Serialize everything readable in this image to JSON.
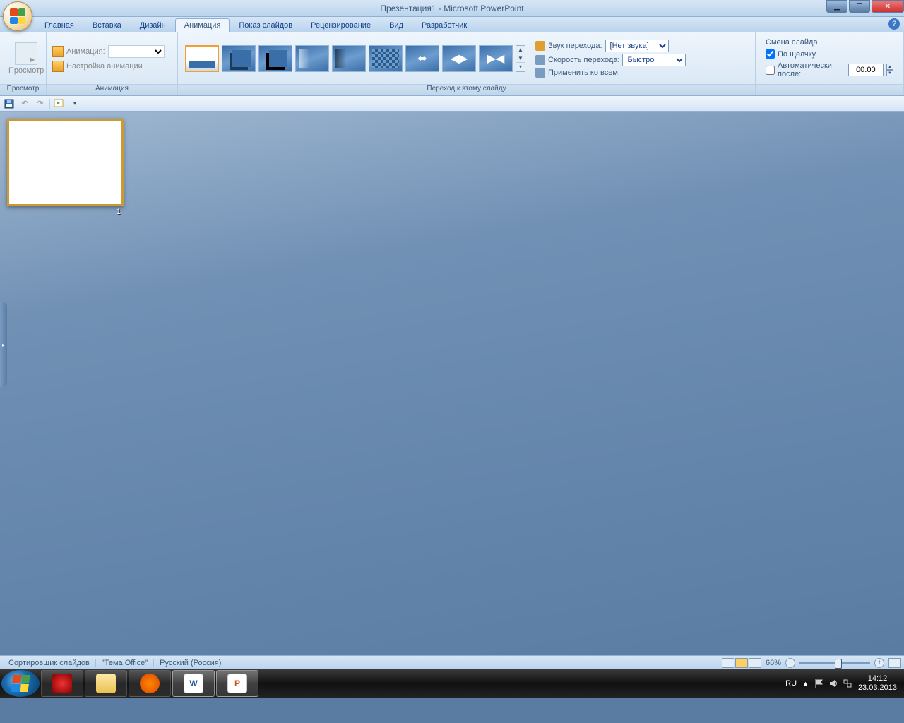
{
  "window": {
    "title": "Презентация1 - Microsoft PowerPoint"
  },
  "tabs": {
    "home": "Главная",
    "insert": "Вставка",
    "design": "Дизайн",
    "animation": "Анимация",
    "slideshow": "Показ слайдов",
    "review": "Рецензирование",
    "view": "Вид",
    "developer": "Разработчик"
  },
  "ribbon": {
    "preview": {
      "button": "Просмотр",
      "group": "Просмотр"
    },
    "animation_group": {
      "label": "Анимация",
      "anim_label": "Анимация:",
      "settings": "Настройка анимации"
    },
    "transition_group": {
      "label": "Переход к этому слайду",
      "sound_label": "Звук перехода:",
      "sound_value": "[Нет звука]",
      "speed_label": "Скорость перехода:",
      "speed_value": "Быстро",
      "apply_all": "Применить ко всем"
    },
    "advance_group": {
      "title": "Смена слайда",
      "on_click": "По щелчку",
      "auto_after": "Автоматически после:",
      "time": "00:00"
    }
  },
  "slide_number": "1",
  "statusbar": {
    "view_name": "Сортировщик слайдов",
    "theme": "\"Тема Office\"",
    "language": "Русский (Россия)",
    "zoom": "66%"
  },
  "systray": {
    "lang": "RU",
    "time": "14:12",
    "date": "23.03.2013"
  }
}
